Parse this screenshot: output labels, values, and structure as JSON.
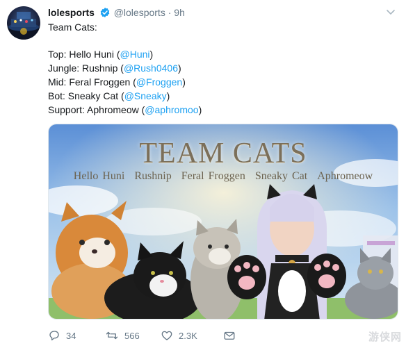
{
  "author": {
    "name": "lolesports",
    "handle": "@lolesports",
    "separator": "·",
    "time": "9h"
  },
  "tweet": {
    "intro": "Team Cats:",
    "lines": [
      {
        "role": "Top: Hello Huni (",
        "mention": "@Huni",
        "close": ")"
      },
      {
        "role": "Jungle: Rushnip (",
        "mention": "@Rush0406",
        "close": ")"
      },
      {
        "role": "Mid: Feral Froggen (",
        "mention": "@Froggen",
        "close": ")"
      },
      {
        "role": "Bot: Sneaky Cat (",
        "mention": "@Sneaky",
        "close": ")"
      },
      {
        "role": "Support: Aphromeow (",
        "mention": "@aphromoo",
        "close": ")"
      }
    ]
  },
  "media": {
    "title": "TEAM CATS",
    "names": [
      "Hello Huni",
      "Rushnip",
      "Feral Froggen",
      "Sneaky Cat",
      "Aphromeow"
    ]
  },
  "actions": {
    "replies": "34",
    "retweets": "566",
    "likes": "2.3K"
  },
  "watermark": "游侠网",
  "colors": {
    "link": "#1da1f2",
    "secondary": "#657786",
    "verified": "#1da1f2",
    "title_text": "#7b6f5a"
  },
  "icons": [
    "verified-badge-icon",
    "chevron-down-icon",
    "reply-icon",
    "retweet-icon",
    "like-icon",
    "message-icon"
  ]
}
